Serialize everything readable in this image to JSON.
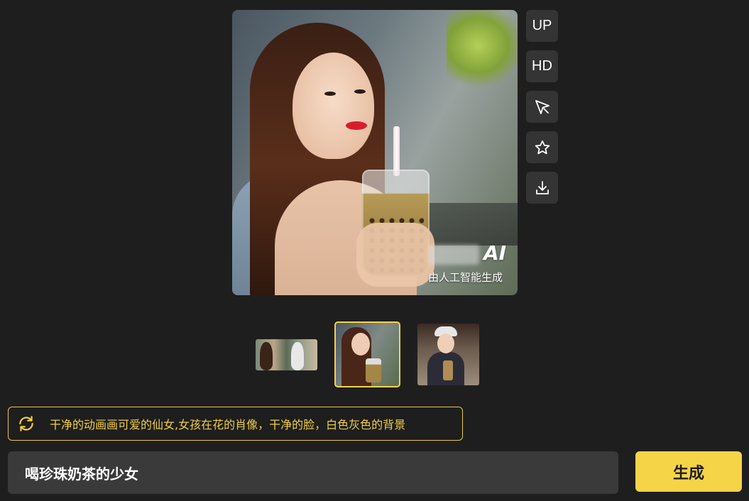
{
  "main_image": {
    "alt": "喝珍珠奶茶的少女",
    "watermark": {
      "badge": "AI",
      "caption": "由人工智能生成"
    }
  },
  "tools": [
    {
      "name": "upscale-button",
      "label": "UP",
      "icon": null
    },
    {
      "name": "hd-button",
      "label": "HD",
      "icon": null
    },
    {
      "name": "share-button",
      "label": "",
      "icon": "paper-plane-icon"
    },
    {
      "name": "favorite-button",
      "label": "",
      "icon": "star-icon"
    },
    {
      "name": "download-button",
      "label": "",
      "icon": "download-icon"
    }
  ],
  "thumbnails": [
    {
      "index": 1,
      "selected": false
    },
    {
      "index": 2,
      "selected": true
    },
    {
      "index": 3,
      "selected": false
    }
  ],
  "suggestion": {
    "icon": "refresh-icon",
    "text": "干净的动画画可爱的仙女,女孩在花的肖像，干净的脸，白色灰色的背景"
  },
  "prompt": {
    "value": "喝珍珠奶茶的少女"
  },
  "generate_button": {
    "label": "生成"
  },
  "colors": {
    "background": "#1e1e1e",
    "accent": "#f5d447",
    "panel": "#343434",
    "input_bg": "#3a3a3a"
  }
}
